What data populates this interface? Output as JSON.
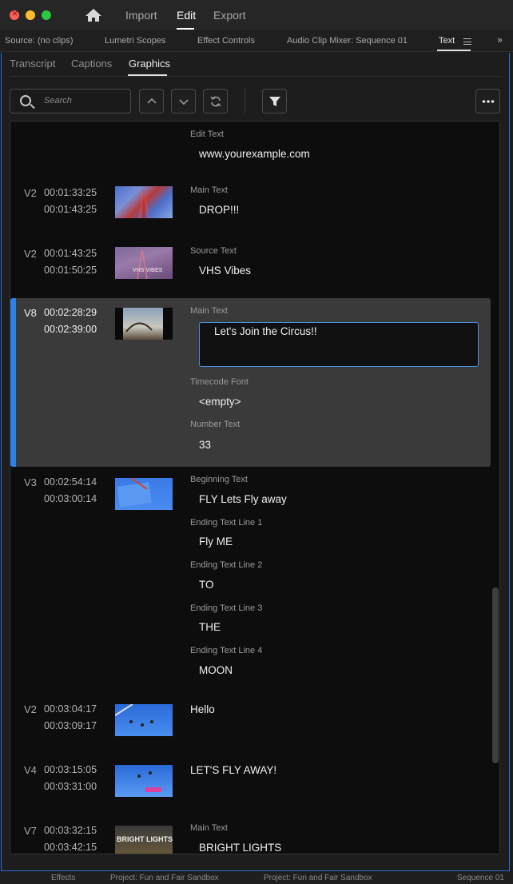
{
  "window": {
    "workspaces": [
      "Import",
      "Edit",
      "Export"
    ],
    "active_workspace": "Edit"
  },
  "panel_tabs": {
    "source": "Source: (no clips)",
    "lumetri": "Lumetri Scopes",
    "effect_controls": "Effect Controls",
    "audio_mixer": "Audio Clip Mixer: Sequence 01",
    "text": "Text"
  },
  "sub_tabs": {
    "transcript": "Transcript",
    "captions": "Captions",
    "graphics": "Graphics",
    "active": "Graphics"
  },
  "search": {
    "placeholder": "Search"
  },
  "rows": [
    {
      "fields": [
        {
          "label": "Edit Text",
          "value": "www.yourexample.com"
        }
      ]
    },
    {
      "track": "V2",
      "in": "00:01:33:25",
      "out": "00:01:43:25",
      "thumb": "red-tower",
      "fields": [
        {
          "label": "Main Text",
          "value": "DROP!!!"
        }
      ]
    },
    {
      "track": "V2",
      "in": "00:01:43:25",
      "out": "00:01:50:25",
      "thumb": "vhs-tower",
      "fields": [
        {
          "label": "Source Text",
          "value": "VHS Vibes"
        }
      ]
    },
    {
      "track": "V8",
      "in": "00:02:28:29",
      "out": "00:02:39:00",
      "thumb": "circus",
      "selected": true,
      "fields": [
        {
          "label": "Main Text",
          "value": "Let's Join the Circus!!"
        },
        {
          "label": "Timecode Font",
          "value": "<empty>"
        },
        {
          "label": "Number Text",
          "value": "33"
        }
      ]
    },
    {
      "track": "V3",
      "in": "00:02:54:14",
      "out": "00:03:00:14",
      "thumb": "sky-ride",
      "fields": [
        {
          "label": "Beginning Text",
          "value": "FLY Lets Fly away"
        },
        {
          "label": "Ending Text Line 1",
          "value": "Fly ME"
        },
        {
          "label": "Ending Text Line 2",
          "value": "TO"
        },
        {
          "label": "Ending Text Line 3",
          "value": "THE"
        },
        {
          "label": "Ending Text Line 4",
          "value": "MOON"
        }
      ]
    },
    {
      "track": "V2",
      "in": "00:03:04:17",
      "out": "00:03:09:17",
      "thumb": "swings",
      "fields": [
        {
          "value": "Hello"
        }
      ]
    },
    {
      "track": "V4",
      "in": "00:03:15:05",
      "out": "00:03:31:00",
      "thumb": "swings-pink",
      "fields": [
        {
          "value": "LET'S FLY AWAY!"
        }
      ]
    },
    {
      "track": "V7",
      "in": "00:03:32:15",
      "out": "00:03:42:15",
      "thumb": "bright-lights",
      "fields": [
        {
          "label": "Main Text",
          "value": "BRIGHT LIGHTS"
        }
      ]
    }
  ],
  "thumb_text": {
    "vhs": "VHS VIBES",
    "bright": "BRIGHT LIGHTS"
  },
  "bottom_tabs": [
    "Effects",
    "Project: Fun and Fair Sandbox",
    "Project: Fun and Fair Sandbox",
    "Sequence 01"
  ]
}
